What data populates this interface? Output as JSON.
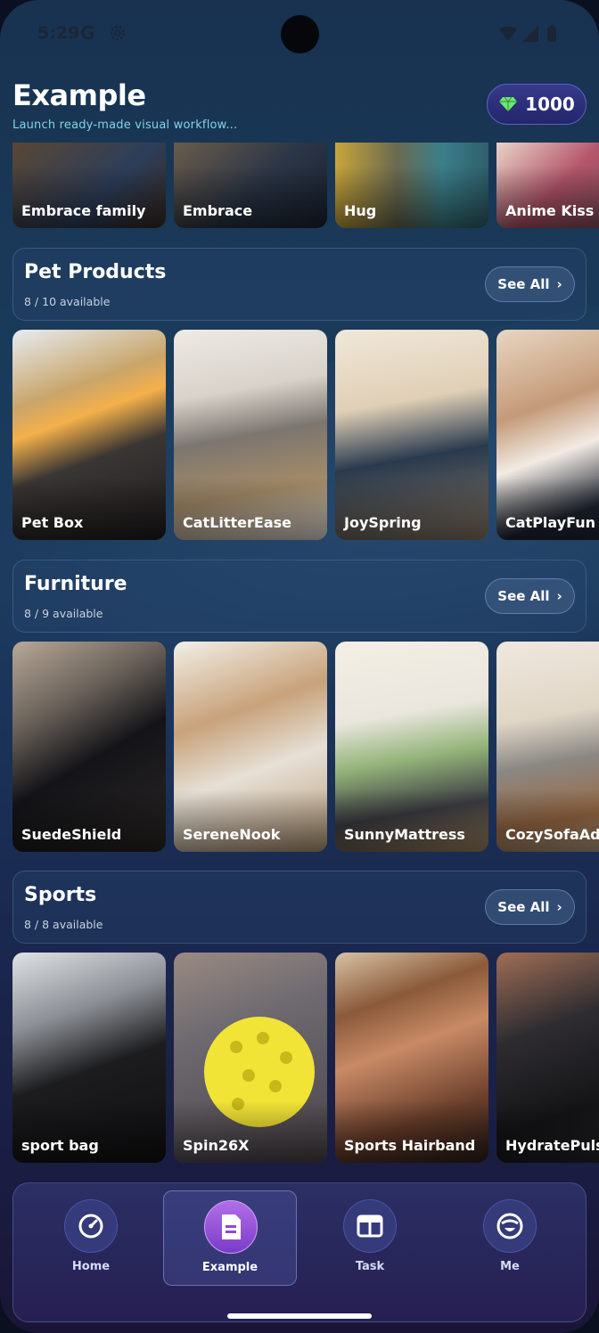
{
  "status_bar": {
    "time": "5:29",
    "g_letter": "G"
  },
  "header": {
    "title": "Example",
    "subtitle": "Launch ready-made visual workflow...",
    "coins": "1000"
  },
  "top_row": [
    {
      "label": "Embrace  family"
    },
    {
      "label": "Embrace"
    },
    {
      "label": "Hug"
    },
    {
      "label": "Anime Kiss"
    }
  ],
  "sections": [
    {
      "name": "Pet Products",
      "available": "8 / 10 available",
      "see_all": "See All",
      "cards": [
        {
          "label": "Pet Box"
        },
        {
          "label": "CatLitterEase"
        },
        {
          "label": "JoySpring"
        },
        {
          "label": "CatPlayFun"
        }
      ]
    },
    {
      "name": "Furniture",
      "available": "8 / 9 available",
      "see_all": "See All",
      "cards": [
        {
          "label": "SuedeShield"
        },
        {
          "label": "SereneNook"
        },
        {
          "label": "SunnyMattress"
        },
        {
          "label": "CozySofaAd"
        }
      ]
    },
    {
      "name": "Sports",
      "available": "8 / 8 available",
      "see_all": "See All",
      "cards": [
        {
          "label": "sport bag"
        },
        {
          "label": "Spin26X"
        },
        {
          "label": "Sports Hairband"
        },
        {
          "label": "HydratePuls"
        }
      ]
    }
  ],
  "nav": {
    "items": [
      {
        "label": "Home",
        "icon": "gauge-icon",
        "active": false
      },
      {
        "label": "Example",
        "icon": "document-icon",
        "active": true
      },
      {
        "label": "Task",
        "icon": "box-icon",
        "active": false
      },
      {
        "label": "Me",
        "icon": "face-icon",
        "active": false
      }
    ]
  },
  "colors": {
    "accent_purple": "#9b55dc",
    "subtitle_cyan": "#7fd3e6",
    "gem_green": "#6ee870"
  }
}
